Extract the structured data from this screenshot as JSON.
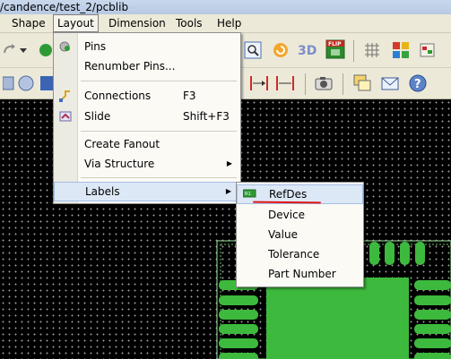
{
  "window": {
    "path": "/candence/test_2/pcblib"
  },
  "menubar": {
    "items": [
      {
        "label": "Shape"
      },
      {
        "label": "Layout"
      },
      {
        "label": "Dimension"
      },
      {
        "label": "Tools"
      },
      {
        "label": "Help"
      }
    ]
  },
  "layout_menu": {
    "items": [
      {
        "label": "Pins",
        "shortcut": "",
        "icon": "pins-icon"
      },
      {
        "label": "Renumber Pins...",
        "shortcut": "",
        "icon": ""
      },
      {
        "label": "Connections",
        "shortcut": "F3",
        "icon": "connections-icon"
      },
      {
        "label": "Slide",
        "shortcut": "Shift+F3",
        "icon": "slide-icon"
      },
      {
        "label": "Create Fanout",
        "shortcut": "",
        "icon": ""
      },
      {
        "label": "Via Structure",
        "shortcut": "",
        "icon": "",
        "submenu": true
      },
      {
        "label": "Labels",
        "shortcut": "",
        "icon": "",
        "submenu": true,
        "highlighted": true
      }
    ]
  },
  "labels_submenu": {
    "items": [
      {
        "label": "RefDes",
        "icon": "refdes-icon",
        "highlighted": true
      },
      {
        "label": "Device"
      },
      {
        "label": "Value"
      },
      {
        "label": "Tolerance"
      },
      {
        "label": "Part Number"
      }
    ]
  },
  "colors": {
    "menu_highlight": "#dde8f7",
    "canvas_background": "#000000",
    "pad_color": "#3db93d",
    "annotation_red": "#e01616"
  }
}
